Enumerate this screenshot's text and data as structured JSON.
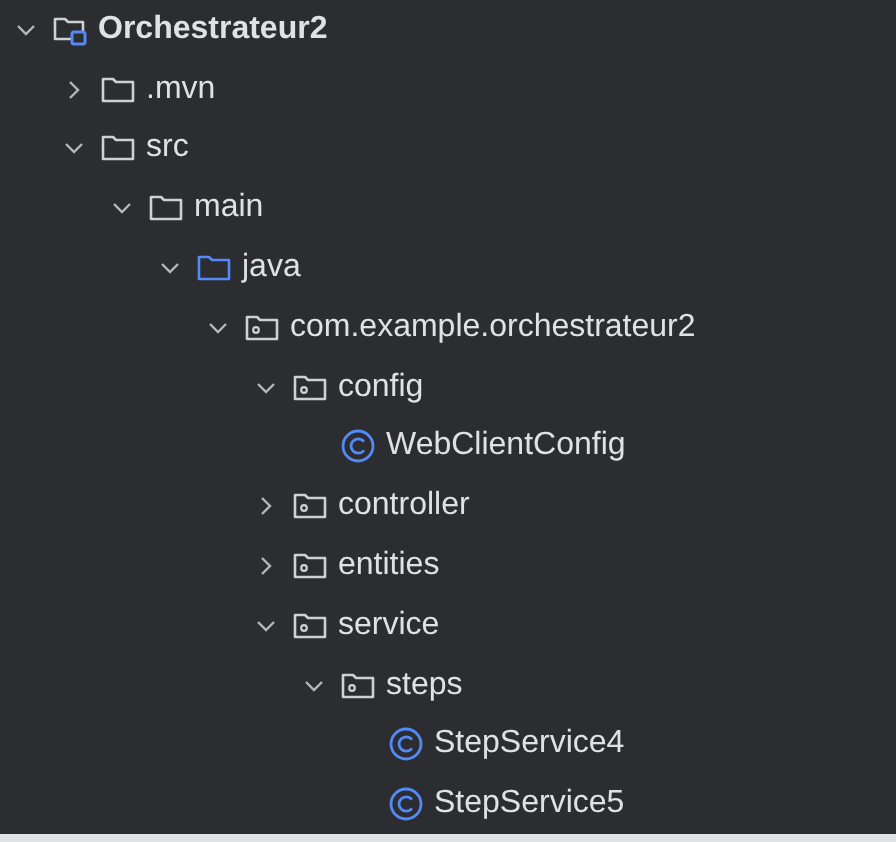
{
  "tree": [
    {
      "label": "Orchestrateur2",
      "kind": "module",
      "expanded": true,
      "children": [
        {
          "label": ".mvn",
          "kind": "folder",
          "expanded": false
        },
        {
          "label": "src",
          "kind": "folder",
          "expanded": true,
          "children": [
            {
              "label": "main",
              "kind": "folder",
              "expanded": true,
              "children": [
                {
                  "label": "java",
                  "kind": "source-folder",
                  "expanded": true,
                  "children": [
                    {
                      "label": "com.example.orchestrateur2",
                      "kind": "package",
                      "expanded": true,
                      "children": [
                        {
                          "label": "config",
                          "kind": "package",
                          "expanded": true,
                          "children": [
                            {
                              "label": "WebClientConfig",
                              "kind": "class"
                            }
                          ]
                        },
                        {
                          "label": "controller",
                          "kind": "package",
                          "expanded": false
                        },
                        {
                          "label": "entities",
                          "kind": "package",
                          "expanded": false
                        },
                        {
                          "label": "service",
                          "kind": "package",
                          "expanded": true,
                          "children": [
                            {
                              "label": "steps",
                              "kind": "package",
                              "expanded": true,
                              "children": [
                                {
                                  "label": "StepService4",
                                  "kind": "class"
                                },
                                {
                                  "label": "StepService5",
                                  "kind": "class"
                                }
                              ]
                            }
                          ]
                        }
                      ]
                    }
                  ]
                }
              ]
            }
          ]
        }
      ]
    }
  ]
}
